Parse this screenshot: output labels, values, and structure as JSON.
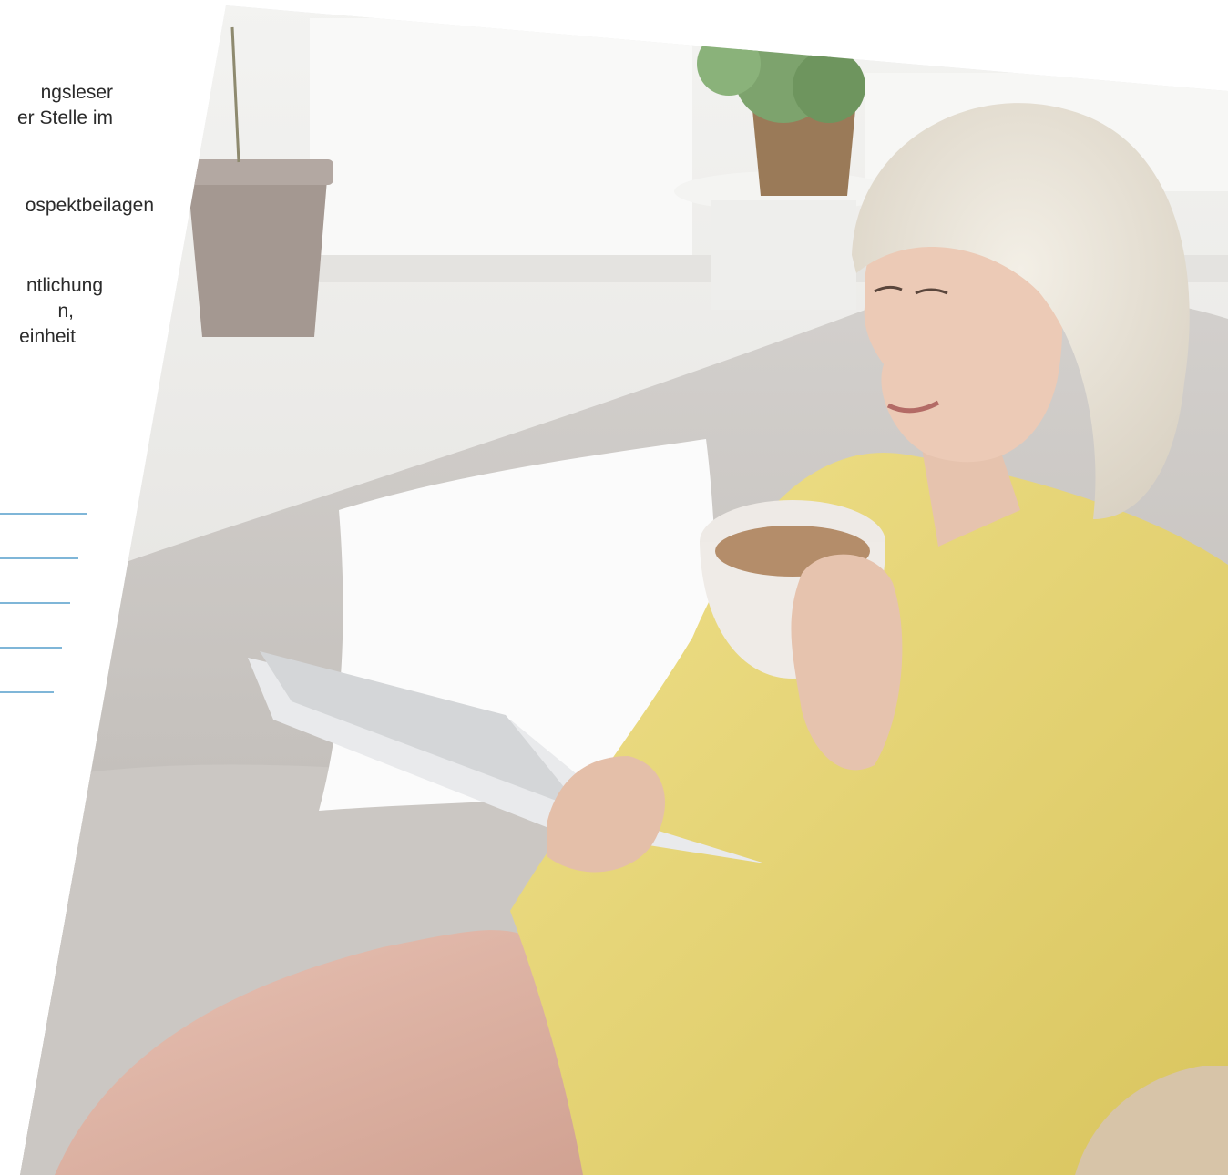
{
  "intro_text": {
    "para1": [
      "ngsleser",
      "er Stelle im"
    ],
    "para2": [
      "ospektbeilagen"
    ],
    "para3": [
      "ntlichung",
      "n,",
      "einheit"
    ]
  },
  "colors": {
    "rule_blue": "#7fb6d8",
    "text": "#2b2b2b"
  },
  "photo": {
    "subject": "Woman on sofa reading a newspaper while drinking coffee",
    "shown_text": []
  }
}
